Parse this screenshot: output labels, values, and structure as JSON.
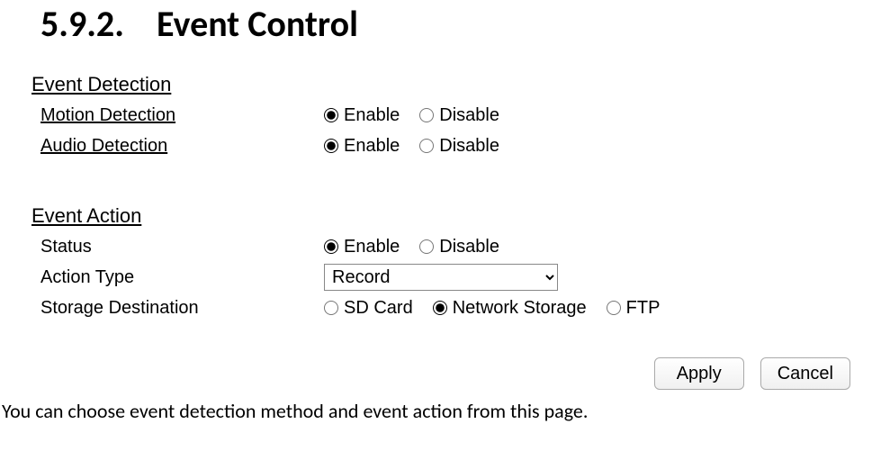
{
  "heading": {
    "number": "5.9.2.",
    "title": "Event Control"
  },
  "sections": {
    "detection": {
      "title": "Event Detection",
      "motion": {
        "label": "Motion Detection",
        "enable": "Enable",
        "disable": "Disable",
        "selected": "enable"
      },
      "audio": {
        "label": "Audio Detection",
        "enable": "Enable",
        "disable": "Disable",
        "selected": "enable"
      }
    },
    "action": {
      "title": "Event Action",
      "status": {
        "label": "Status",
        "enable": "Enable",
        "disable": "Disable",
        "selected": "enable"
      },
      "actionType": {
        "label": "Action Type",
        "value": "Record"
      },
      "storage": {
        "label": "Storage Destination",
        "options": {
          "sd": "SD Card",
          "net": "Network Storage",
          "ftp": "FTP"
        },
        "selected": "net"
      }
    }
  },
  "buttons": {
    "apply": "Apply",
    "cancel": "Cancel"
  },
  "footer": "You can choose event detection method and event action from this page."
}
